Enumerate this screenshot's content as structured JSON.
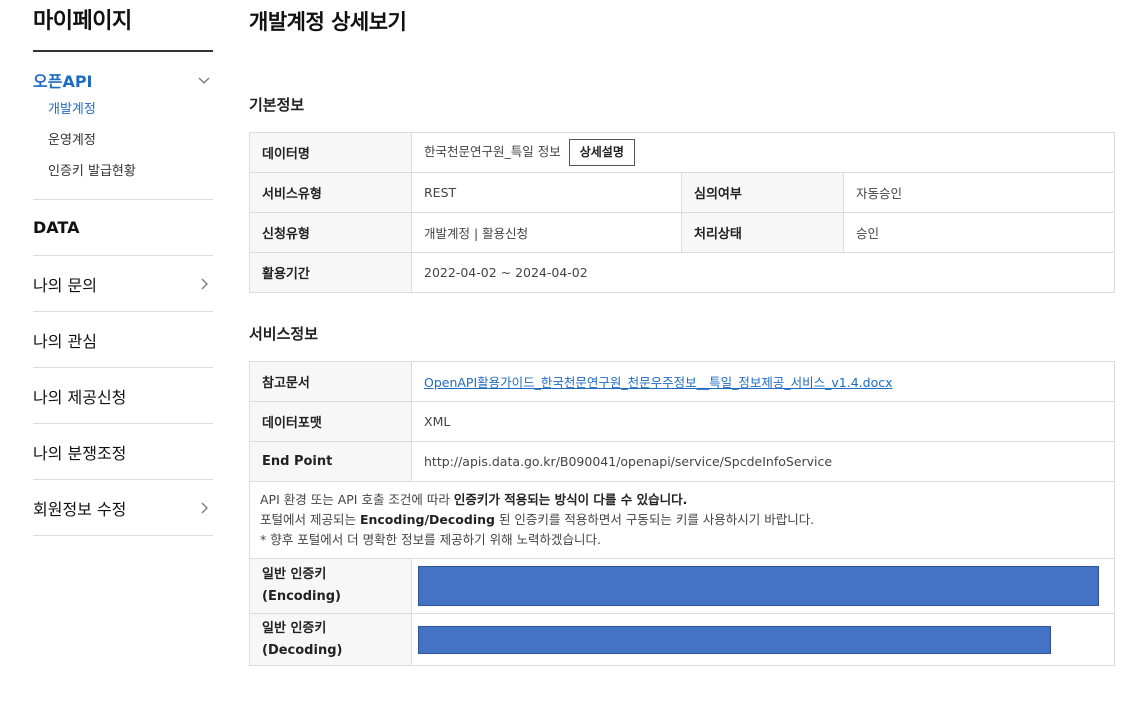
{
  "sidebar": {
    "title": "마이페이지",
    "menu": [
      {
        "label": "오픈API",
        "active": true,
        "expanded": true,
        "children": [
          "개발계정",
          "운영계정",
          "인증키 발급현황"
        ]
      },
      {
        "label": "DATA"
      },
      {
        "label": "나의 문의"
      },
      {
        "label": "나의 관심"
      },
      {
        "label": "나의 제공신청"
      },
      {
        "label": "나의 분쟁조정"
      },
      {
        "label": "회원정보 수정"
      }
    ]
  },
  "page": {
    "title": "개발계정 상세보기"
  },
  "basic": {
    "section_title": "기본정보",
    "data_name_label": "데이터명",
    "data_name_value": "한국천문연구원_특일 정보",
    "detail_button": "상세설명",
    "service_type_label": "서비스유형",
    "service_type_value": "REST",
    "review_label": "심의여부",
    "review_value": "자동승인",
    "apply_type_label": "신청유형",
    "apply_type_value": "개발계정 | 활용신청",
    "status_label": "처리상태",
    "status_value": "승인",
    "period_label": "활용기간",
    "period_value": "2022-04-02 ~ 2024-04-02"
  },
  "service": {
    "section_title": "서비스정보",
    "ref_doc_label": "참고문서",
    "ref_doc_value": "OpenAPI활용가이드_한국천문연구원_천문우주정보__특일_정보제공_서비스_v1.4.docx",
    "format_label": "데이터포맷",
    "format_value": "XML",
    "endpoint_label": "End Point",
    "endpoint_value": "http://apis.data.go.kr/B090041/openapi/service/SpcdeInfoService",
    "notice": {
      "line1_a": "API 환경 또는 API 호출 조건에 따라 ",
      "line1_b": "인증키가 적용되는 방식이 다를 수 있습니다.",
      "line2_a": "포털에서 제공되는 ",
      "line2_b": "Encoding/Decoding",
      "line2_c": " 된 인증키를 적용하면서 구동되는 키를 사용하시기 바랍니다.",
      "line3": "* 향후 포털에서 더 명확한 정보를 제공하기 위해 노력하겠습니다."
    },
    "key_enc_label": "일반 인증키",
    "key_enc_sub": "(Encoding)",
    "key_dec_label": "일반 인증키",
    "key_dec_sub": "(Decoding)"
  },
  "colors": {
    "accent": "#1e6bc4",
    "redaction": "#4472c4"
  },
  "icons": {
    "expand": "chevron-down-icon",
    "more": "chevron-right-icon"
  }
}
